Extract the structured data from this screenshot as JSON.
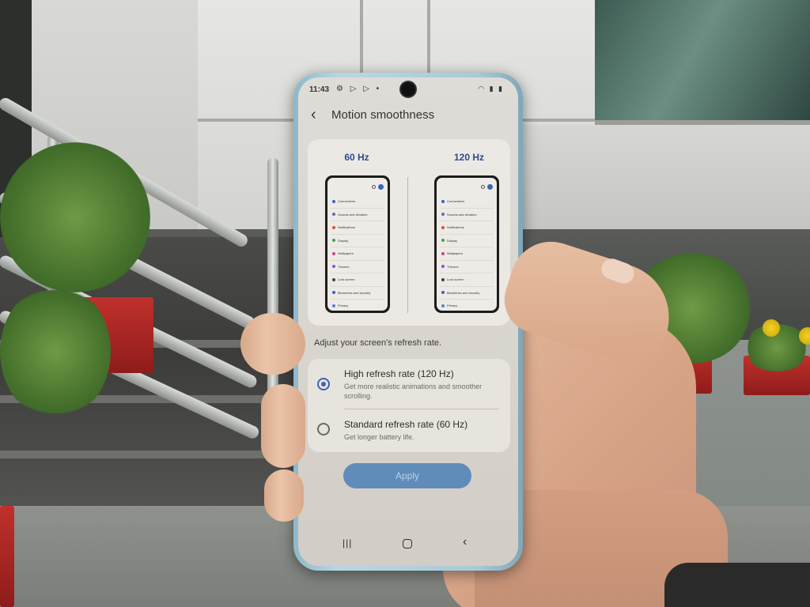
{
  "status_bar": {
    "time": "11:43",
    "left_icons": "⚙ ▷ ▷ •",
    "right_icons": "◠ ▮ ▮"
  },
  "header": {
    "title": "Motion smoothness"
  },
  "preview": {
    "left_label": "60 Hz",
    "right_label": "120 Hz",
    "mini_items": [
      {
        "label": "Connections",
        "color": "#3a64b8"
      },
      {
        "label": "Sounds and vibration",
        "color": "#7a5cc2"
      },
      {
        "label": "Notifications",
        "color": "#d0533b"
      },
      {
        "label": "Display",
        "color": "#4f9d4a"
      },
      {
        "label": "Wallpapers",
        "color": "#c2487a"
      },
      {
        "label": "Themes",
        "color": "#8a56c9"
      },
      {
        "label": "Lock screen",
        "color": "#3f3f3f"
      },
      {
        "label": "Biometrics and security",
        "color": "#3a64b8"
      },
      {
        "label": "Privacy",
        "color": "#5a7fd0"
      }
    ]
  },
  "hint": "Adjust your screen's refresh rate.",
  "options": [
    {
      "title": "High refresh rate (120 Hz)",
      "description": "Get more realistic animations and smoother scrolling.",
      "selected": true
    },
    {
      "title": "Standard refresh rate (60 Hz)",
      "description": "Get longer battery life.",
      "selected": false
    }
  ],
  "apply_label": "Apply",
  "nav": {
    "recents_icon": "|||",
    "back_icon": "‹"
  },
  "colors": {
    "accent": "#3a64b8",
    "apply_bg": "#5f8cb9",
    "phone_frame": "#a9cad8"
  }
}
